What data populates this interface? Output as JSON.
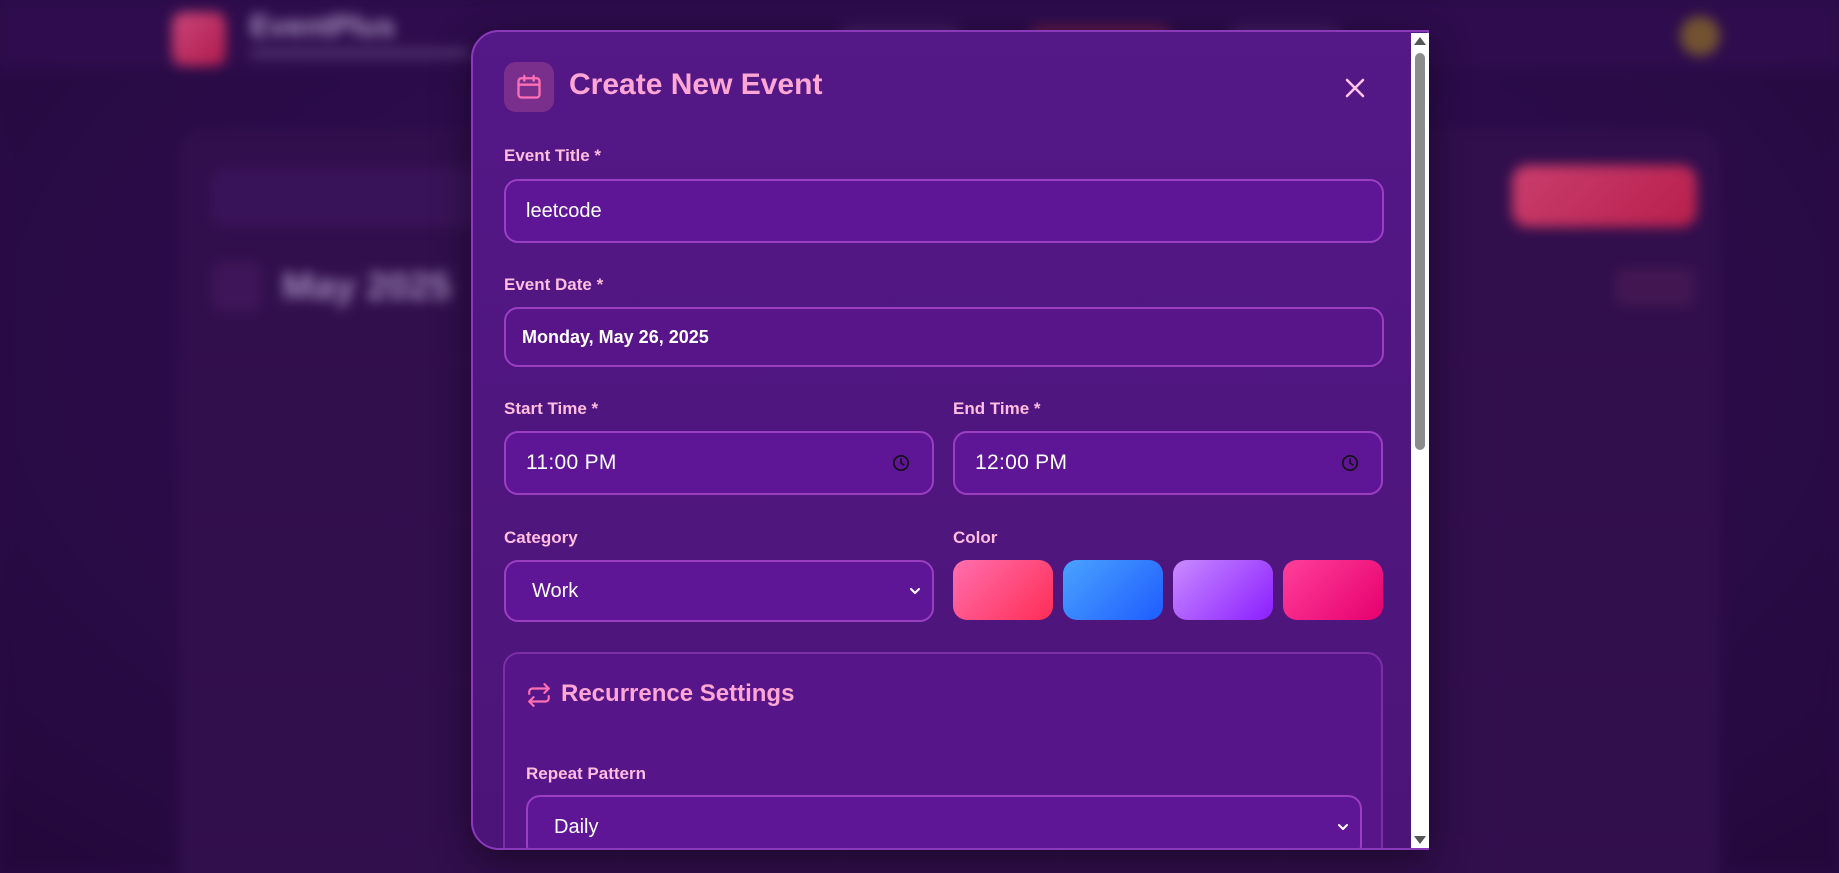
{
  "background": {
    "brand": "EventPlus",
    "month": "May 2025"
  },
  "modal": {
    "title": "Create New Event",
    "icons": {
      "header": "calendar-icon",
      "close": "close-icon"
    }
  },
  "form": {
    "title": {
      "label": "Event Title *",
      "value": "leetcode"
    },
    "date": {
      "label": "Event Date *",
      "value": "Monday, May 26, 2025"
    },
    "start_time": {
      "label": "Start Time *",
      "value": "11:00 PM",
      "icon": "clock-icon"
    },
    "end_time": {
      "label": "End Time *",
      "value": "12:00 PM",
      "icon": "clock-icon"
    },
    "category": {
      "label": "Category",
      "value": "Work",
      "icon": "chevron-down-icon"
    },
    "color": {
      "label": "Color",
      "swatches": [
        {
          "name": "pink-red",
          "from": "#ff6fae",
          "to": "#ff2d55"
        },
        {
          "name": "blue",
          "from": "#4aa3ff",
          "to": "#1e5cff"
        },
        {
          "name": "purple",
          "from": "#c98bff",
          "to": "#8b1eff"
        },
        {
          "name": "magenta",
          "from": "#ff3f9a",
          "to": "#e6006e"
        }
      ]
    }
  },
  "recurrence": {
    "title": "Recurrence Settings",
    "icon": "repeat-icon",
    "pattern": {
      "label": "Repeat Pattern",
      "value": "Daily",
      "icon": "chevron-down-icon"
    }
  },
  "colors": {
    "accent_pink": "#ffa6d4",
    "label_pink": "#ffbde0",
    "field_bg": "#5e1596",
    "field_border": "#9a3fc2",
    "modal_bg": "#541887"
  }
}
